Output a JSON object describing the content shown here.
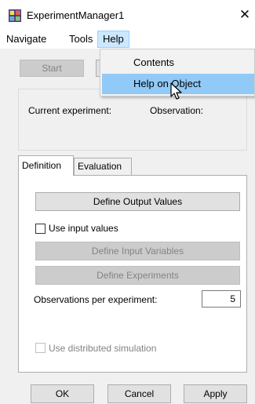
{
  "window": {
    "title": "ExperimentManager1",
    "close_glyph": "✕"
  },
  "menubar": {
    "items": [
      "Navigate",
      "Tools",
      "Help"
    ]
  },
  "help_menu": {
    "items": [
      "Contents",
      "Help on Object"
    ],
    "highlighted_index": 1
  },
  "toolbar": {
    "start_label": "Start"
  },
  "status": {
    "current_experiment_label": "Current experiment:",
    "observation_label": "Observation:"
  },
  "tabs": [
    {
      "label": "Definition",
      "active": true
    },
    {
      "label": "Evaluation",
      "active": false
    }
  ],
  "definition": {
    "define_output_values_label": "Define Output Values",
    "use_input_values_label": "Use input values",
    "use_input_values_checked": false,
    "define_input_variables_label": "Define Input Variables",
    "define_experiments_label": "Define Experiments",
    "observations_label": "Observations per experiment:",
    "observations_value": "5",
    "use_distributed_simulation_label": "Use distributed simulation",
    "use_distributed_simulation_checked": false
  },
  "footer": {
    "ok_label": "OK",
    "cancel_label": "Cancel",
    "apply_label": "Apply"
  },
  "colors": {
    "menu_highlight": "#cce8ff",
    "dropdown_highlight": "#91c9f7",
    "dialog_bg": "#f0f0f0",
    "disabled_text": "#838383"
  },
  "icons": {
    "app": "experiment-manager-icon",
    "close": "close-icon",
    "cursor": "mouse-pointer-icon"
  }
}
